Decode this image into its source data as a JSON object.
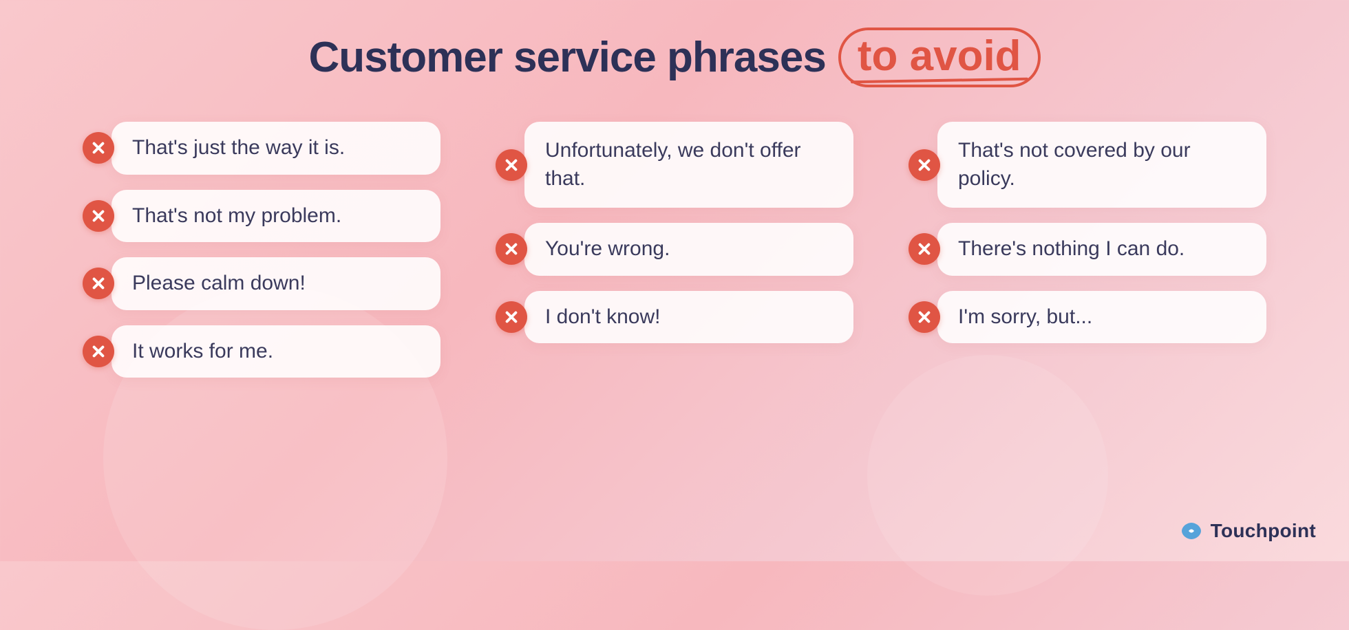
{
  "header": {
    "title_part1": "Customer service phrases",
    "title_highlight": "to avoid"
  },
  "columns": [
    {
      "id": "col1",
      "phrases": [
        {
          "id": "p1",
          "text": "That's just the way it is."
        },
        {
          "id": "p2",
          "text": "That's not my problem."
        },
        {
          "id": "p3",
          "text": "Please calm down!"
        },
        {
          "id": "p4",
          "text": "It works for me."
        }
      ]
    },
    {
      "id": "col2",
      "phrases": [
        {
          "id": "p5",
          "text": "Unfortunately, we don't offer that."
        },
        {
          "id": "p6",
          "text": "You're wrong."
        },
        {
          "id": "p7",
          "text": "I don't know!"
        }
      ]
    },
    {
      "id": "col3",
      "phrases": [
        {
          "id": "p8",
          "text": "That's not covered by our policy."
        },
        {
          "id": "p9",
          "text": "There's nothing I can do."
        },
        {
          "id": "p10",
          "text": "I'm sorry, but..."
        }
      ]
    }
  ],
  "branding": {
    "name": "Touchpoint"
  },
  "colors": {
    "accent": "#e05544",
    "dark": "#2d3157"
  }
}
